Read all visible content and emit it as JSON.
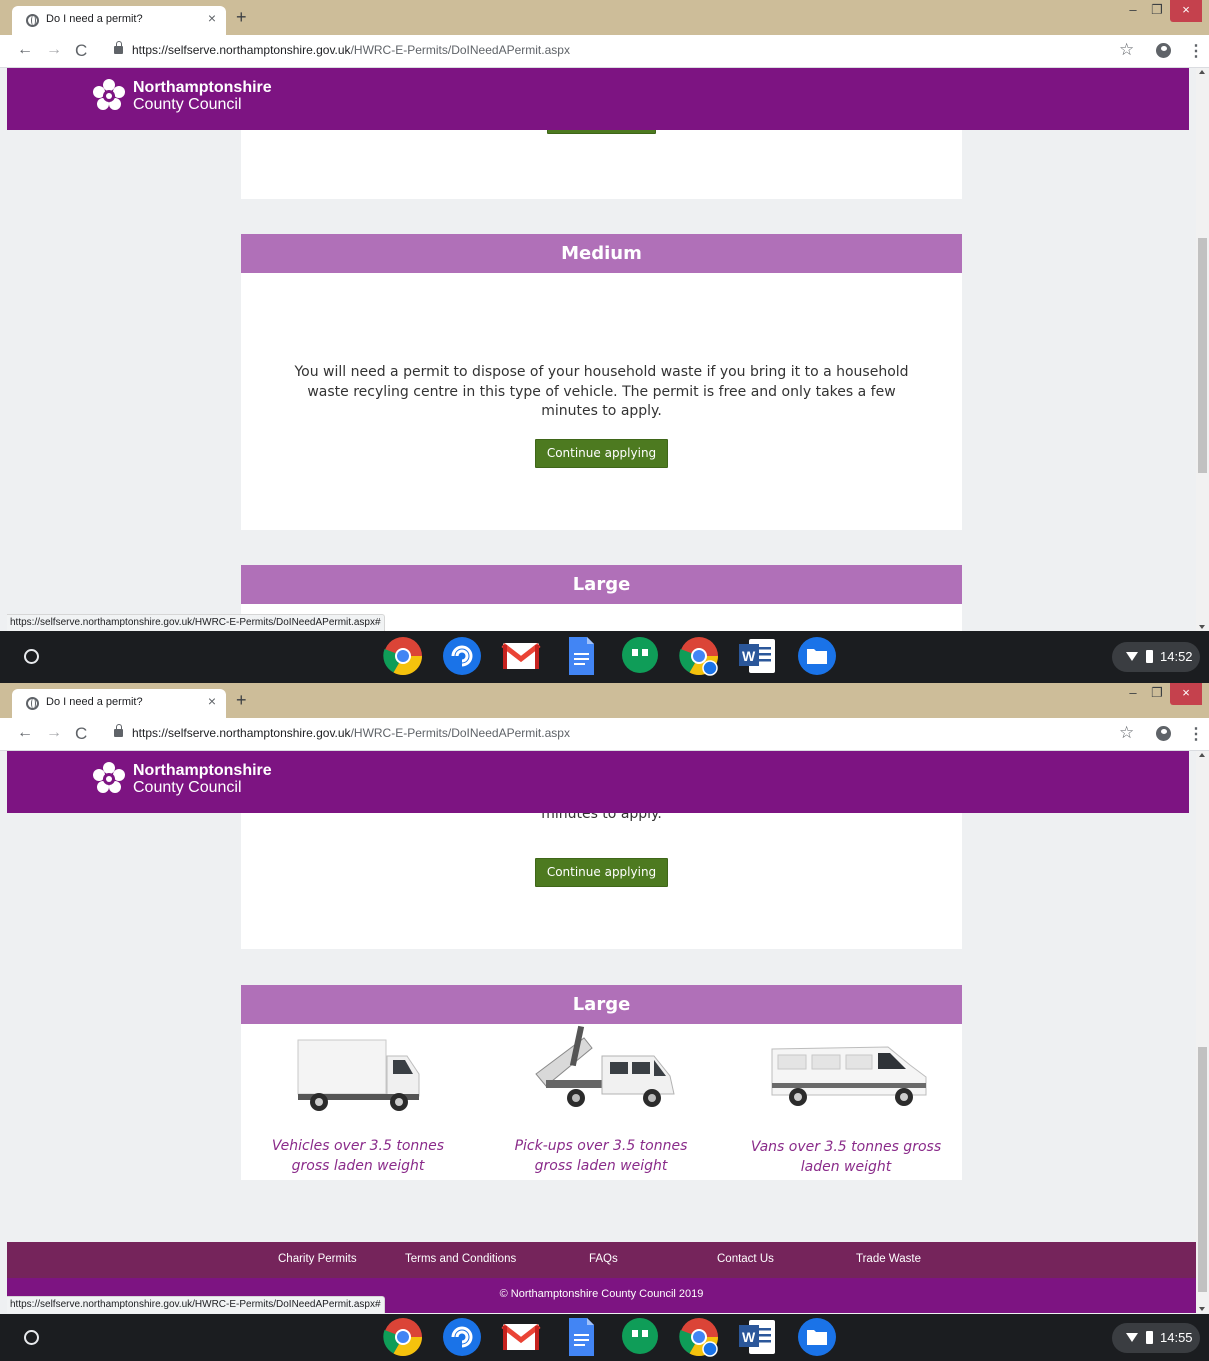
{
  "browser": {
    "tab_title": "Do I need a permit?",
    "tab_close": "×",
    "new_tab": "+",
    "url_host": "https://selfserve.northamptonshire.gov.uk",
    "url_path": "/HWRC-E-Permits/DoINeedAPermit.aspx",
    "status_url": "https://selfserve.northamptonshire.gov.uk/HWRC-E-Permits/DoINeedAPermit.aspx#",
    "window_min": "–",
    "window_max": "❐",
    "window_close": "×",
    "icons": [
      "globe-icon",
      "back-arrow-icon",
      "forward-arrow-icon",
      "reload-icon",
      "lock-icon",
      "star-icon",
      "profile-icon",
      "menu-kebab-icon"
    ]
  },
  "site": {
    "logo_line1": "Northamptonshire",
    "logo_line2": "County Council",
    "header_color": "#7d1482",
    "section_header_color": "#b070b8",
    "button_color": "#4d7a20"
  },
  "sections": {
    "medium": {
      "title": "Medium",
      "description": "You will need a permit to dispose of your household waste if you bring it to a household waste recyling centre in this type of vehicle. The permit is free and only takes a few minutes to apply.",
      "description_line1": "You will need a permit to dispose of your household waste if you bring it to a household",
      "description_line2": "waste recyling centre in this type of vehicle. The permit is free and only takes a few",
      "description_line3": "minutes to apply.",
      "button": "Continue applying"
    },
    "large": {
      "title": "Large",
      "vehicles": [
        {
          "caption_line1": "Vehicles over 3.5 tonnes",
          "caption_line2": "gross laden weight",
          "icon": "box-truck-image"
        },
        {
          "caption_line1": "Pick-ups over 3.5 tonnes",
          "caption_line2": "gross laden weight",
          "icon": "tipper-pickup-image"
        },
        {
          "caption_line1": "Vans over 3.5 tonnes gross",
          "caption_line2": "laden weight",
          "icon": "large-van-image"
        }
      ]
    }
  },
  "footer": {
    "links": [
      "Charity Permits",
      "Terms and Conditions",
      "FAQs",
      "Contact Us",
      "Trade Waste"
    ],
    "copyright": "© Northamptonshire County Council 2019"
  },
  "shelf": {
    "apps": [
      "chrome-icon",
      "cast-app-icon",
      "gmail-icon",
      "docs-icon",
      "hangouts-icon",
      "chrome-canary-icon",
      "word-icon",
      "files-icon"
    ],
    "time_first": "14:52",
    "time_second": "14:55"
  }
}
